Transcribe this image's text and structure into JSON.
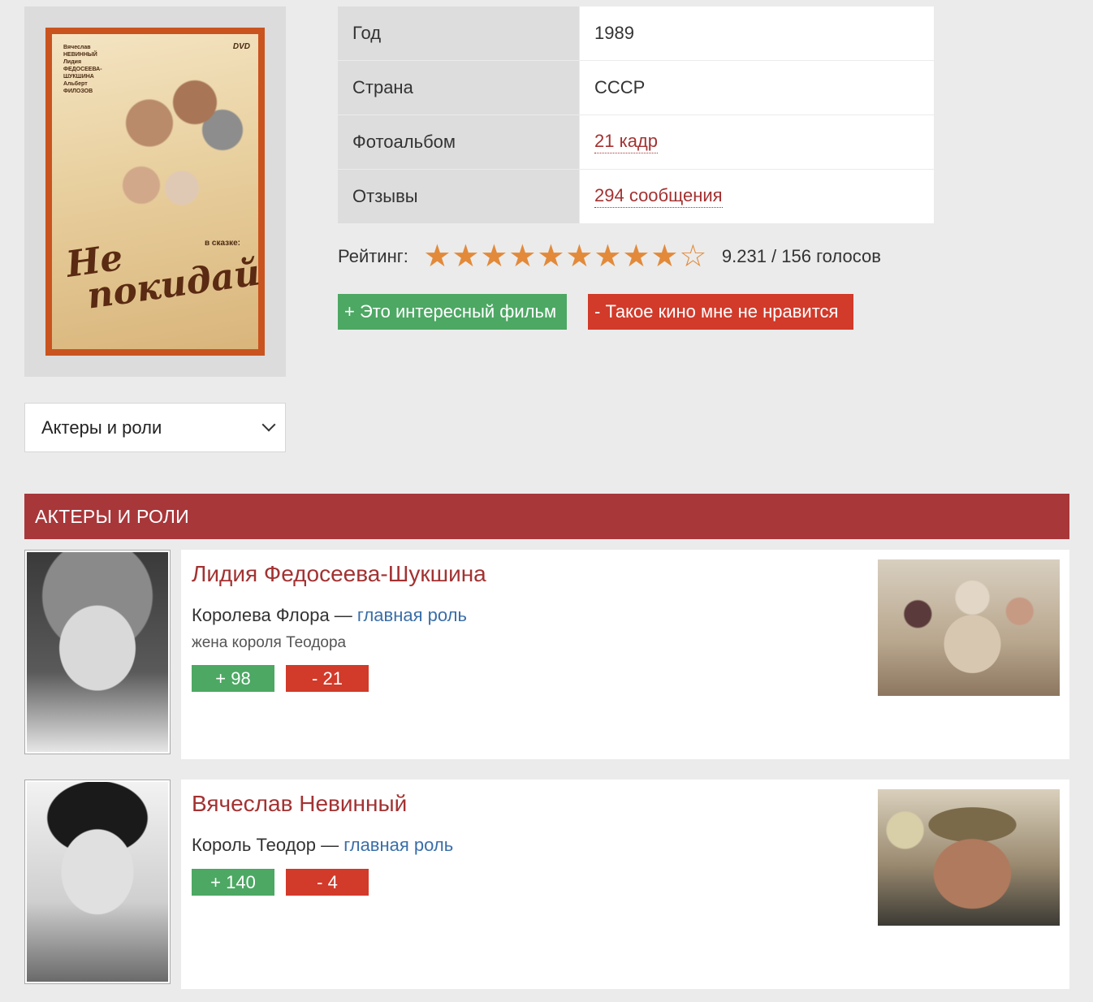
{
  "poster": {
    "credits": "Вячеслав\nНЕВИННЫЙ\nЛидия\nФЕДОСЕЕВА-\nШУКШИНА\nАльберт\nФИЛОЗОВ",
    "dvd": "DVD",
    "tagline": "в сказке:",
    "title_line1": "Не",
    "title_line2": "покидай"
  },
  "info": {
    "rows": [
      {
        "key": "Год",
        "value": "1989",
        "link": false
      },
      {
        "key": "Страна",
        "value": "СССР",
        "link": false
      },
      {
        "key": "Фотоальбом",
        "value": "21 кадр",
        "link": true
      },
      {
        "key": "Отзывы",
        "value": "294 сообщения",
        "link": true
      }
    ]
  },
  "rating": {
    "label": "Рейтинг:",
    "stars_filled": 9.231,
    "stars_total": 10,
    "value_text": "9.231 / 156 голосов"
  },
  "buttons": {
    "like": "+ Это интересный фильм",
    "dislike": "- Такое кино мне не нравится"
  },
  "select": {
    "value": "Актеры и роли"
  },
  "section": {
    "title": "АКТЕРЫ И РОЛИ"
  },
  "actors": [
    {
      "name": "Лидия Федосеева-Шукшина",
      "role": "Королева Флора",
      "sep": " — ",
      "role_type": "главная роль",
      "description": "жена короля Теодора",
      "plus": "+ 98",
      "minus": "- 21"
    },
    {
      "name": "Вячеслав Невинный",
      "role": "Король Теодор",
      "sep": " — ",
      "role_type": "главная роль",
      "description": "",
      "plus": "+ 140",
      "minus": "- 4"
    }
  ],
  "colors": {
    "accent": "#a8373a",
    "link": "#a33232",
    "role_link": "#3a6ea8",
    "like": "#4ca863",
    "dislike": "#d23a2a",
    "star": "#e28a3a"
  }
}
